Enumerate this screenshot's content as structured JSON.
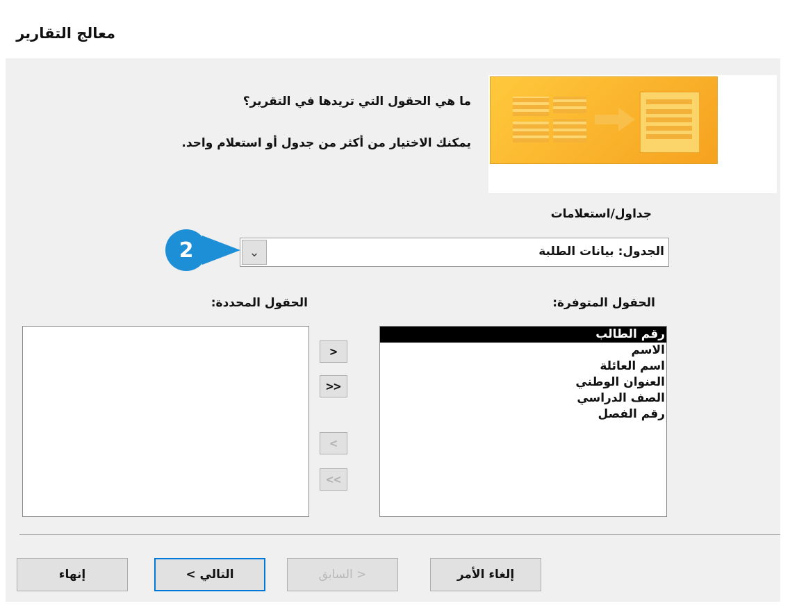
{
  "dialog": {
    "title": "معالج التقارير",
    "question": "ما هي الحقول التي تريدها في التقرير؟",
    "hint": "يمكنك الاختيار من أكثر من جدول أو استعلام واحد.",
    "tables_label": "جداول/استعلامات",
    "source_value": "الجدول: بيانات الطلبة",
    "callout_number": "2",
    "available_label": "الحقول المتوفرة:",
    "selected_label": "الحقول المحددة:",
    "available_fields": [
      "رقم الطالب",
      "الاسم",
      "اسم العائلة",
      "العنوان الوطني",
      "الصف الدراسي",
      "رقم الفصل"
    ],
    "selected_field_index": 0,
    "move_buttons": {
      "add_one": ">",
      "add_all": ">>",
      "remove_one": "<",
      "remove_all": "<<"
    },
    "footer": {
      "cancel": "إلغاء الأمر",
      "back": "< السابق",
      "next": "التالي >",
      "finish": "إنهاء"
    }
  }
}
